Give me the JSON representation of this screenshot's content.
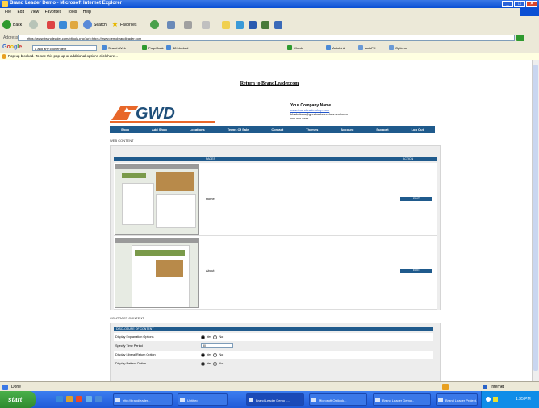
{
  "window": {
    "title": "Brand Leader Demo - Microsoft Internet Explorer"
  },
  "menu": [
    "File",
    "Edit",
    "View",
    "Favorites",
    "Tools",
    "Help"
  ],
  "toolbar": {
    "back": "Back",
    "search": "Search",
    "favorites": "Favorites"
  },
  "address": {
    "label": "Address",
    "url": "https://www.brandleader.com/bltools.php?url=https://www.demobrandleader.com"
  },
  "google": {
    "logo": "Google",
    "query": "a and any chosen text",
    "search_btn": "Search Web",
    "items": [
      "PageRank",
      "48 blocked",
      "Check",
      "AutoLink",
      "AutoFill",
      "Options"
    ]
  },
  "popup": {
    "text": "Pop-up blocked. To see this pop-up or additional options click here..."
  },
  "page": {
    "return_link": "Return to BrandLeader.com",
    "company": {
      "name": "Your Company Name",
      "url": "www.brandleadershop.com",
      "email": "blsolutions@greatwebdevelopment.com",
      "phone": "xxx.xxx.xxxx"
    },
    "nav": [
      "Shop",
      "Add Shop",
      "Locations",
      "Terms Of Sale",
      "Contact",
      "Themes",
      "Account",
      "Support",
      "Log Out"
    ],
    "web_section_title": "WEB CONTENT",
    "web_head": {
      "pages": "PAGES",
      "action": "ACTION"
    },
    "pages": [
      {
        "name": "Home",
        "action": "EDIT"
      },
      {
        "name": "About",
        "action": "EDIT"
      }
    ],
    "contact_section_title": "CONTRACT CONTENT",
    "contact_head": "DISCLOSURE OF CONTENT",
    "contact_rows": [
      {
        "label": "Display Explanation Options",
        "options": [
          "Yes",
          "No"
        ],
        "selected": 0
      },
      {
        "label": "Specify Time Period",
        "select": "30"
      },
      {
        "label": "Display Liberal Return Option",
        "options": [
          "Yes",
          "No"
        ],
        "selected": 0
      },
      {
        "label": "Display Refund Option",
        "options": [
          "Yes",
          "No"
        ],
        "selected": 0
      }
    ]
  },
  "status": {
    "left": "Done",
    "zone": "Internet"
  },
  "taskbar": {
    "start": "start",
    "tasks": [
      "http://brandleader...",
      "Untitled",
      "Brand Leader Demo -...",
      "Microsoft Outlook...",
      "Brand Leader Demo...",
      "Brand Leader Project..."
    ],
    "clock": "1:35 PM"
  }
}
